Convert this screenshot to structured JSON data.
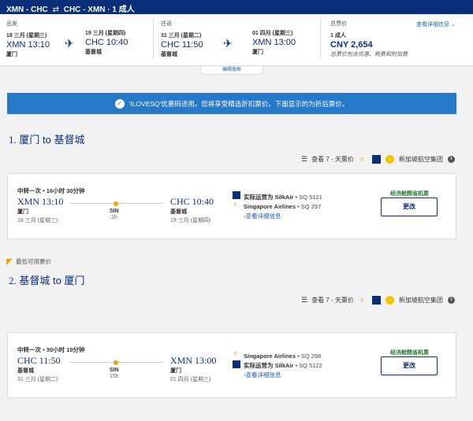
{
  "header": {
    "outbound": "XMN - CHC",
    "return": "CHC - XMN",
    "passengers": "· 1 成人"
  },
  "summary": {
    "depart_label": "出发",
    "return_label": "往返",
    "total_label": "总票价",
    "outbound": {
      "dep_date": "18 三月 (星期三)",
      "dep_time": "XMN 13:10",
      "dep_city": "厦门",
      "arr_date": "19 三月 (星期四)",
      "arr_time": "CHC 10:40",
      "arr_city": "基督城"
    },
    "return": {
      "dep_date": "31 三月 (星期二)",
      "dep_time": "CHC 11:50",
      "dep_city": "基督城",
      "arr_date": "01 四月 (星期三)",
      "arr_time": "XMN 13:00",
      "arr_city": "厦门"
    },
    "pax": "1 成人",
    "price": "CNY 2,654",
    "price_note": "总票价包含优惠、税费和附加费",
    "detail_link": "查看详细信息",
    "edit_search": "编辑搜索"
  },
  "promo": {
    "text": "'ILOVESQ'优惠码适用。您将享受精选折扣票价。下面显示的为折后票价。"
  },
  "fare_tools": {
    "seven_day": "查看 7 - 天票价",
    "group": "新加坡航空集团"
  },
  "section1": {
    "number": "1.",
    "title": "厦门 to 基督城",
    "stops": "中转一次 • 16小时 30分钟",
    "dep_time": "XMN 13:10",
    "dep_city": "厦门",
    "dep_date": "18 三月 (星期三)",
    "via": "SIN",
    "via_dur": "2h",
    "arr_time": "CHC 10:40",
    "arr_city": "基督城",
    "arr_date": "19 三月 (星期四)",
    "airline1": "实际运营为 SilkAir",
    "flight1": "• SQ 5121",
    "airline2": "Singapore Airlines",
    "flight2": "• SQ 297",
    "detail": "›查看详细信息",
    "cabin": "经济舱精省机票",
    "change": "更改"
  },
  "badge": {
    "lowest": "最低可用票价"
  },
  "section2": {
    "number": "2.",
    "title": "基督城 to 厦门",
    "stops": "中转一次 • 30小时 10分钟",
    "dep_time": "CHC 11:50",
    "dep_city": "基督城",
    "dep_date": "31 三月 (星期二)",
    "via": "SIN",
    "via_dur": "15h",
    "arr_time": "XMN 13:00",
    "arr_city": "厦门",
    "arr_date": "01 四月 (星期三)",
    "airline1": "Singapore Airlines",
    "flight1": "• SQ 298",
    "airline2": "实际运营为 SilkAir",
    "flight2": "• SQ 5122",
    "detail": "›查看详细信息",
    "cabin": "经济舱精省机票",
    "change": "更改"
  },
  "colors": {
    "navy": "#0a2e7a",
    "promo_blue": "#2678c8",
    "accent_orange": "#f0a500",
    "cabin_green": "#1b7a2e"
  }
}
